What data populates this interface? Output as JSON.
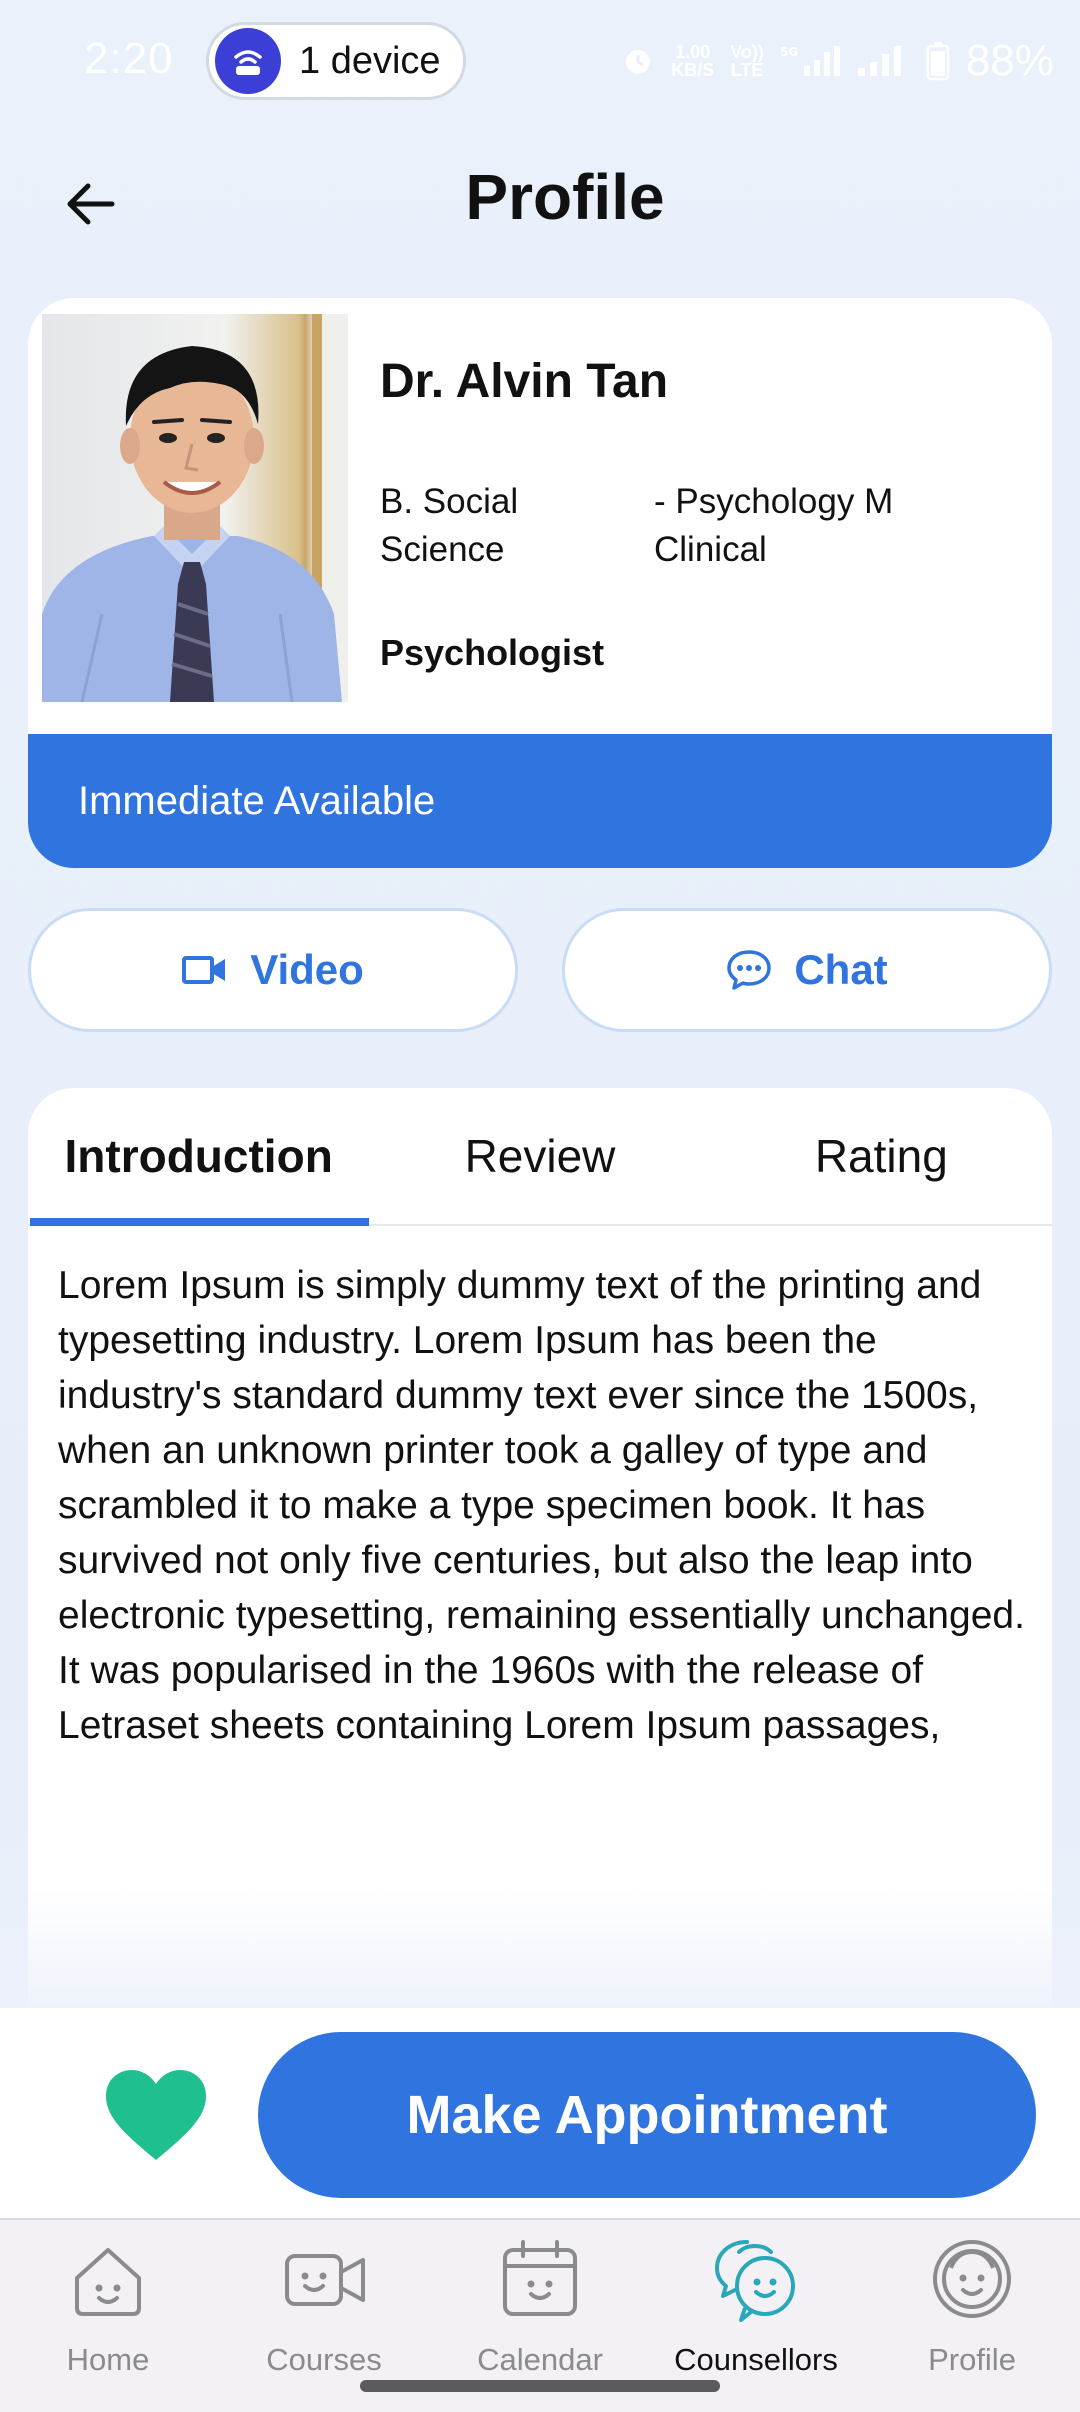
{
  "status_bar": {
    "time": "2:20",
    "device_pill": "1 device",
    "net_speed_top": "1.00",
    "net_speed_bottom": "KB/S",
    "vowifi_top": "Vo))",
    "vowifi_bottom": "LTE",
    "signal_label": "5G",
    "battery": "88%"
  },
  "header": {
    "title": "Profile"
  },
  "profile": {
    "name": "Dr. Alvin Tan",
    "qualification_1": "B. Social Science",
    "qualification_2": "- Psychology M Clinical",
    "role": "Psychologist",
    "availability": "Immediate Available"
  },
  "actions": {
    "video_label": "Video",
    "chat_label": "Chat"
  },
  "tabs": [
    {
      "label": "Introduction",
      "active": true
    },
    {
      "label": "Review",
      "active": false
    },
    {
      "label": "Rating",
      "active": false
    }
  ],
  "introduction_text": "Lorem Ipsum is simply dummy text of the printing and typesetting industry. Lorem Ipsum has been the industry's standard dummy text ever since the 1500s, when an unknown printer took a galley of type and scrambled it to make a type specimen book. It has survived not only five centuries, but also the leap into electronic typesetting, remaining essentially unchanged. It was popularised in the 1960s with the release of Letraset sheets containing Lorem Ipsum passages,",
  "appointment": {
    "button_label": "Make Appointment",
    "favorite_icon": "heart-icon"
  },
  "bottom_nav": [
    {
      "label": "Home",
      "icon": "home-face-icon",
      "active": false
    },
    {
      "label": "Courses",
      "icon": "video-face-icon",
      "active": false
    },
    {
      "label": "Calendar",
      "icon": "calendar-face-icon",
      "active": false
    },
    {
      "label": "Counsellors",
      "icon": "chat-bubbles-icon",
      "active": true
    },
    {
      "label": "Profile",
      "icon": "face-icon",
      "active": false
    }
  ],
  "colors": {
    "accent": "#2f74df",
    "favorite": "#1fbf8f",
    "nav_active": "#2aa7b8",
    "nav_inactive": "#8a8a8f"
  }
}
